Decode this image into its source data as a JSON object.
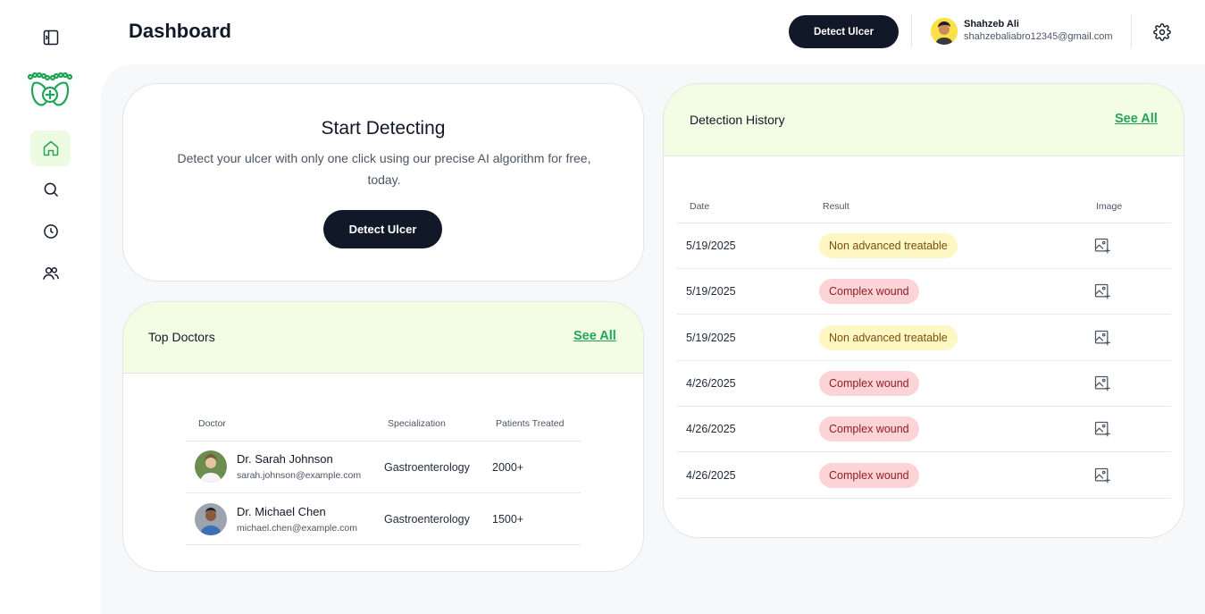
{
  "header": {
    "title": "Dashboard",
    "detect_button": "Detect Ulcer",
    "user": {
      "name": "Shahzeb Ali",
      "email": "shahzebaliabro12345@gmail.com"
    }
  },
  "sidebar": {
    "items": [
      {
        "icon": "home-icon",
        "active": true
      },
      {
        "icon": "search-icon",
        "active": false
      },
      {
        "icon": "clock-icon",
        "active": false
      },
      {
        "icon": "users-icon",
        "active": false
      }
    ]
  },
  "start_card": {
    "title": "Start Detecting",
    "description": "Detect your ulcer with only one click using our precise AI algorithm for free, today.",
    "button": "Detect Ulcer"
  },
  "top_doctors": {
    "title": "Top Doctors",
    "see_all": "See All",
    "columns": [
      "Doctor",
      "Specialization",
      "Patients Treated"
    ],
    "rows": [
      {
        "name": "Dr. Sarah Johnson",
        "email": "sarah.johnson@example.com",
        "specialization": "Gastroenterology",
        "patients": "2000+"
      },
      {
        "name": "Dr. Michael Chen",
        "email": "michael.chen@example.com",
        "specialization": "Gastroenterology",
        "patients": "1500+"
      }
    ]
  },
  "history": {
    "title": "Detection History",
    "see_all": "See All",
    "columns": [
      "Date",
      "Result",
      "Image"
    ],
    "rows": [
      {
        "date": "5/19/2025",
        "result": "Non advanced treatable",
        "status": "yellow"
      },
      {
        "date": "5/19/2025",
        "result": "Complex wound",
        "status": "red"
      },
      {
        "date": "5/19/2025",
        "result": "Non advanced treatable",
        "status": "yellow"
      },
      {
        "date": "4/26/2025",
        "result": "Complex wound",
        "status": "red"
      },
      {
        "date": "4/26/2025",
        "result": "Complex wound",
        "status": "red"
      },
      {
        "date": "4/26/2025",
        "result": "Complex wound",
        "status": "red"
      }
    ]
  },
  "colors": {
    "accent_green": "#22a55a",
    "dark_button": "#111827",
    "header_tint": "#f2fde4",
    "badge_yellow": "#fef6c3",
    "badge_red": "#fcd4d7"
  }
}
